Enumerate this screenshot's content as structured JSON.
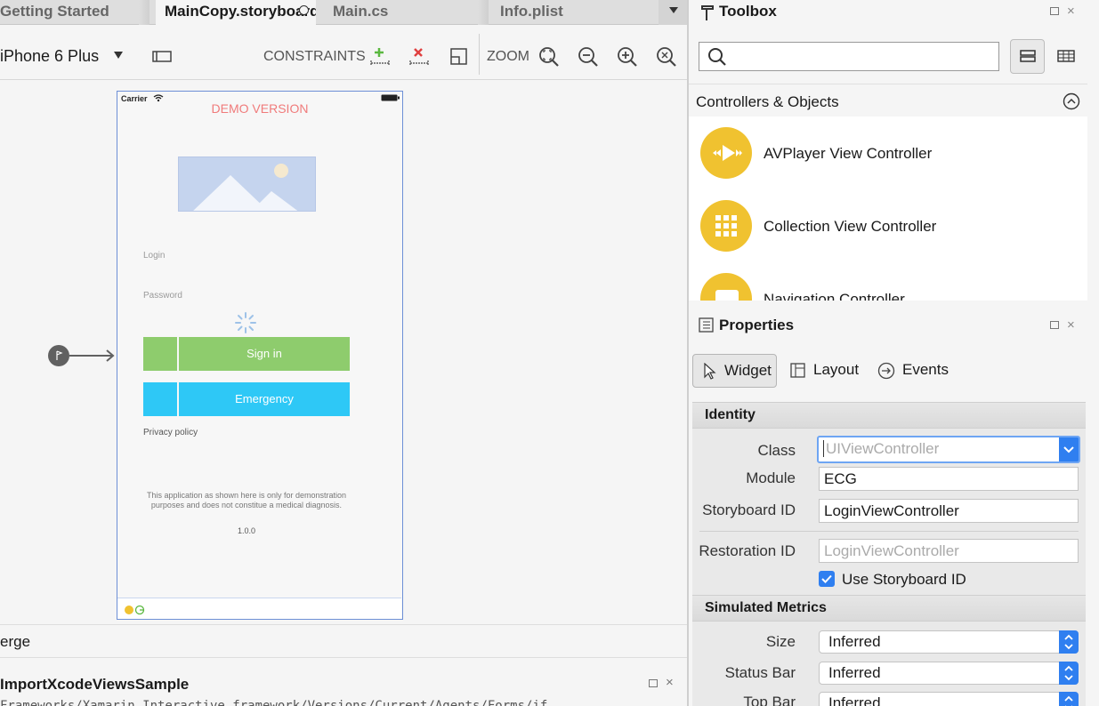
{
  "tabs": [
    {
      "label": "Getting Started",
      "active": false
    },
    {
      "label": "MainCopy.storyboard",
      "active": true
    },
    {
      "label": "Main.cs",
      "active": false
    },
    {
      "label": "Info.plist",
      "active": false
    }
  ],
  "designer_toolbar": {
    "device": "iPhone 6 Plus",
    "constraints_label": "CONSTRAINTS",
    "zoom_label": "ZOOM"
  },
  "phone": {
    "carrier": "Carrier",
    "demo_label": "DEMO VERSION",
    "login_placeholder": "Login",
    "password_placeholder": "Password",
    "signin_label": "Sign in",
    "emergency_label": "Emergency",
    "privacy_label": "Privacy policy",
    "disclaimer_line1": "This application as shown here is only for demonstration",
    "disclaimer_line2": "purposes and does not constitue a medical diagnosis.",
    "version": "1.0.0",
    "colors": {
      "demo": "#f07b7b",
      "signin": "#8ecc6d",
      "emergency": "#2ec8f6",
      "image": "#c5d4ee"
    }
  },
  "bottom": {
    "merge_label": "erge",
    "pad_title": "ImportXcodeViewsSample",
    "path_text": "Frameworks/Xamarin.Interactive.framework/Versions/Current/Agents/Forms/if"
  },
  "toolbox": {
    "title": "Toolbox",
    "search_placeholder": "",
    "section_title": "Controllers & Objects",
    "items": [
      {
        "label": "AVPlayer View Controller",
        "icon": "play-icon"
      },
      {
        "label": "Collection View Controller",
        "icon": "grid-icon"
      },
      {
        "label": "Navigation Controller",
        "icon": "navigation-icon"
      }
    ],
    "accent": "#f0c230"
  },
  "properties": {
    "title": "Properties",
    "tabs": [
      "Widget",
      "Layout",
      "Events"
    ],
    "identity_header": "Identity",
    "class_label": "Class",
    "class_placeholder": "UIViewController",
    "module_label": "Module",
    "module_value": "ECG",
    "storyboard_id_label": "Storyboard ID",
    "storyboard_id_value": "LoginViewController",
    "restoration_id_label": "Restoration ID",
    "restoration_id_placeholder": "LoginViewController",
    "use_storyboard_id_label": "Use Storyboard ID",
    "use_storyboard_id_checked": true,
    "simulated_header": "Simulated Metrics",
    "size_label": "Size",
    "size_value": "Inferred",
    "status_bar_label": "Status Bar",
    "status_bar_value": "Inferred",
    "top_bar_label": "Top Bar",
    "top_bar_value": "Inferred",
    "accent": "#2f7ff0"
  }
}
